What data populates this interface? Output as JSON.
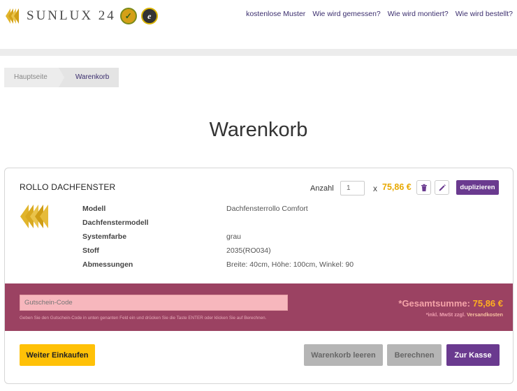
{
  "header": {
    "brand": "SUNLUX 24",
    "nav": [
      "kostenlose Muster",
      "Wie wird gemessen?",
      "Wie wird montiert?",
      "Wie wird bestellt?"
    ]
  },
  "breadcrumb": [
    "Hauptseite",
    "Warenkorb"
  ],
  "page_title": "Warenkorb",
  "cart": {
    "product_title": "ROLLO DACHFENSTER",
    "qty_label": "Anzahl",
    "qty_value": "1",
    "times": "x",
    "price": "75,86 €",
    "duplicate_label": "duplizieren",
    "specs": [
      {
        "label": "Modell",
        "value": "Dachfensterrollo Comfort"
      },
      {
        "label": "Dachfenstermodell",
        "value": ""
      },
      {
        "label": "Systemfarbe",
        "value": "grau"
      },
      {
        "label": "Stoff",
        "value": "2035(RO034)"
      },
      {
        "label": "Abmessungen",
        "value": "Breite: 40cm, Höhe: 100cm, Winkel: 90"
      }
    ]
  },
  "coupon": {
    "placeholder": "Gutschein-Code",
    "hint": "Geben Sie den Gutschein-Code in unten genanten Feld ein und drücken Sie die Taste ENTER oder klicken Sie auf Berechnen."
  },
  "totals": {
    "label": "*Gesamtsumme:",
    "value": "75,86 €",
    "vat_text": "*inkl. MwSt zzgl.",
    "shipping_link": "Versandkosten"
  },
  "buttons": {
    "continue": "Weiter Einkaufen",
    "empty_cart": "Warenkorb leeren",
    "calculate": "Berechnen",
    "checkout": "Zur Kasse"
  },
  "colors": {
    "accent_purple": "#6a3a8f",
    "price_gold": "#e8a800",
    "coupon_band": "#9b4262",
    "continue_yellow": "#ffc107"
  }
}
